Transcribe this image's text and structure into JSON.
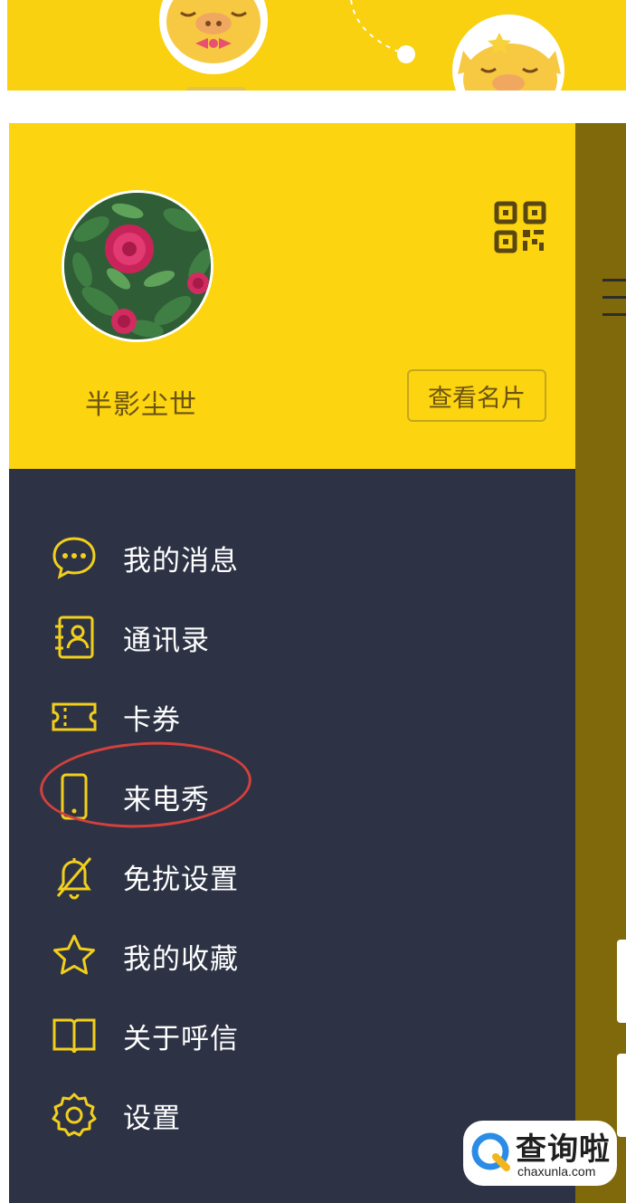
{
  "profile": {
    "username": "半影尘世",
    "view_card_label": "查看名片"
  },
  "menu": {
    "items": [
      {
        "label": "我的消息",
        "icon": "message-bubble-icon"
      },
      {
        "label": "通讯录",
        "icon": "contacts-icon"
      },
      {
        "label": "卡券",
        "icon": "ticket-icon"
      },
      {
        "label": "来电秀",
        "icon": "phone-icon"
      },
      {
        "label": "免扰设置",
        "icon": "bell-muted-icon"
      },
      {
        "label": "我的收藏",
        "icon": "star-icon"
      },
      {
        "label": "关于呼信",
        "icon": "book-icon"
      },
      {
        "label": "设置",
        "icon": "gear-icon"
      }
    ]
  },
  "watermark": {
    "name": "查询啦",
    "url": "chaxunla.com"
  },
  "colors": {
    "header_yellow": "#fcd40f",
    "drawer_navy": "#2d3345",
    "icon_yellow": "#f2cf1c",
    "annotation_red": "#d4403d"
  }
}
